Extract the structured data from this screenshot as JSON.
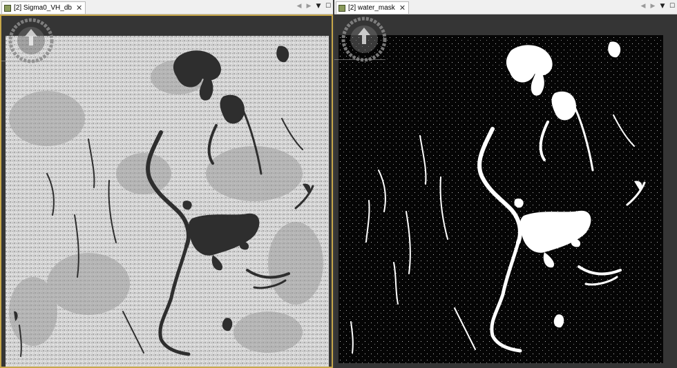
{
  "left_view": {
    "tab_title": "[2] Sigma0_VH_db",
    "close_glyph": "✕",
    "controls": [
      "◀",
      "▶",
      "▼",
      "☐"
    ],
    "icon": "band-image-icon"
  },
  "right_view": {
    "tab_title": "[2] water_mask",
    "close_glyph": "✕",
    "controls": [
      "◀",
      "▶",
      "▼",
      "☐"
    ],
    "icon": "band-image-icon"
  },
  "colors": {
    "active_border": "#c8a84a",
    "sar_light": "#d9d9d9",
    "sar_dark": "#2e2e2e",
    "mask_water": "#ffffff",
    "mask_land": "#050505"
  }
}
